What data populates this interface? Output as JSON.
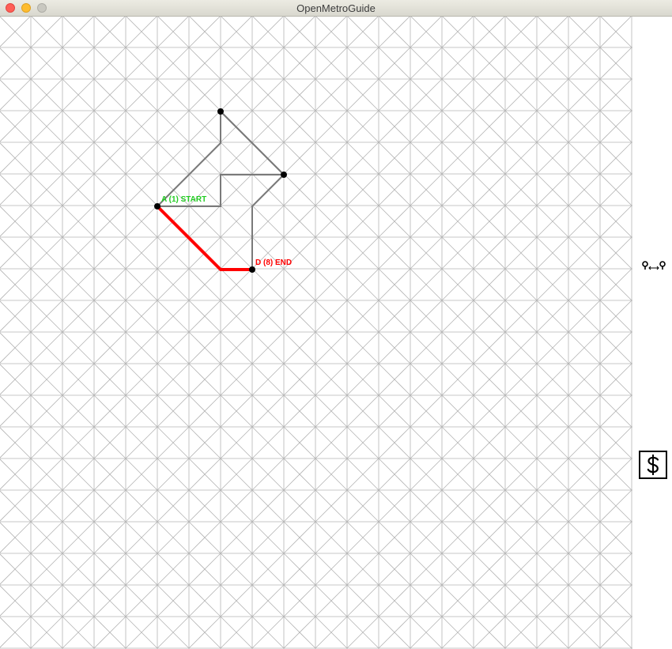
{
  "window": {
    "title": "OpenMetroGuide",
    "controls": [
      "close-button",
      "minimize-button",
      "zoom-button"
    ]
  },
  "map": {
    "grid_color": "#b4b4b4",
    "line_color": "#7a7a7a",
    "route_color": "#ff0000",
    "station_color": "#000000",
    "start_label_color": "#22cc22",
    "end_label_color": "#ff0000",
    "start_station": {
      "label": "A (1) START"
    },
    "end_station": {
      "label": "D (8) END"
    }
  },
  "toolbar": {
    "route_tool_icon": "pin-to-pin-icon",
    "fare_icon": "dollar-icon"
  }
}
